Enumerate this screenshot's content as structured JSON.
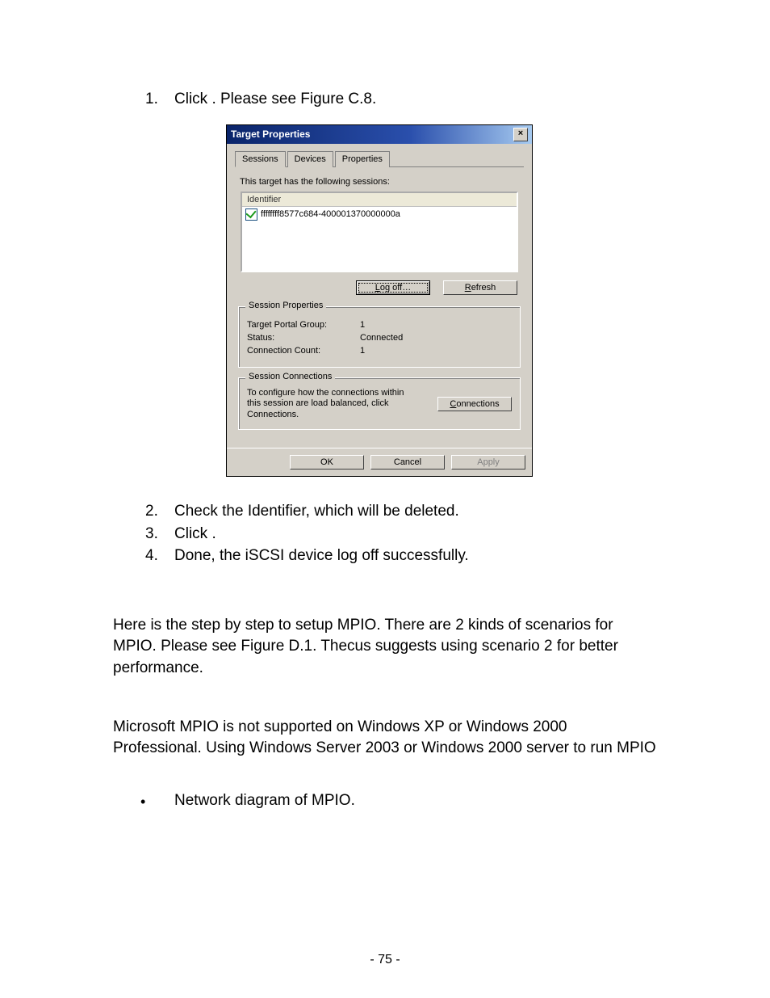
{
  "steps_top": [
    {
      "num": "1.",
      "text": "Click               . Please see Figure C.8."
    }
  ],
  "dialog": {
    "title": "Target Properties",
    "tabs": [
      "Sessions",
      "Devices",
      "Properties"
    ],
    "intro": "This target has the following sessions:",
    "list_header": "Identifier",
    "list_item": "ffffffff8577c684-400001370000000a",
    "logoff_label_pre": "L",
    "logoff_label_post": "og off…",
    "refresh_label_pre": "R",
    "refresh_label_post": "efresh",
    "session_group_title": "Session Properties",
    "props": {
      "portal_label": "Target Portal Group:",
      "portal_value": "1",
      "status_label": "Status:",
      "status_value": "Connected",
      "count_label": "Connection Count:",
      "count_value": "1"
    },
    "conn_group_title": "Session Connections",
    "conn_text": "To configure how the connections within this session are load balanced, click Connections.",
    "connections_label_pre": "C",
    "connections_label_post": "onnections",
    "ok_label": "OK",
    "cancel_label": "Cancel",
    "apply_label": "Apply"
  },
  "steps_bottom": [
    {
      "num": "2.",
      "text": "Check the Identifier, which will be deleted."
    },
    {
      "num": "3.",
      "text": "Click                ."
    },
    {
      "num": "4.",
      "text": "Done, the iSCSI device log off successfully."
    }
  ],
  "para1": "Here is the step by step to setup MPIO. There are 2 kinds of scenarios for MPIO. Please see Figure D.1. Thecus suggests using scenario 2 for better performance.",
  "para2": "Microsoft MPIO is not supported on Windows XP or Windows 2000 Professional. Using Windows Server 2003 or Windows 2000 server to run MPIO",
  "bullet": "Network diagram of MPIO.",
  "pagenum": "- 75 -"
}
